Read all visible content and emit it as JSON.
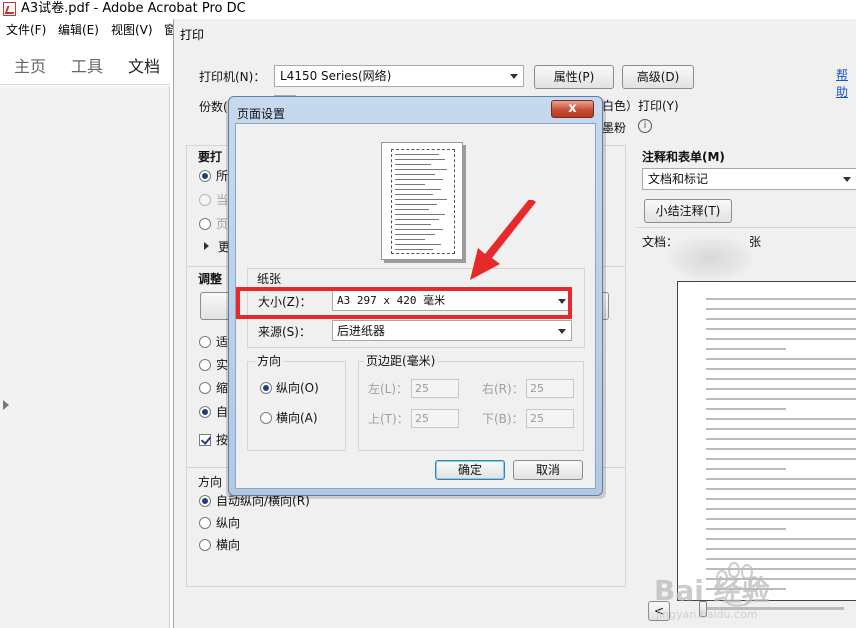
{
  "app": {
    "title": "A3试卷.pdf - Adobe Acrobat Pro DC",
    "menu": [
      "文件(F)",
      "编辑(E)",
      "视图(V)",
      "窗"
    ],
    "tabs": [
      "主页",
      "工具",
      "文档"
    ]
  },
  "print_dialog": {
    "title": "打印",
    "printer_label": "打印机(N)：",
    "printer_value": "L4150 Series(网络)",
    "properties_button": "属性(P)",
    "advanced_button": "高级(D)",
    "help_link": "帮助",
    "copies_label": "份数(",
    "grayscale_text": "白色）打印(Y)",
    "save_ink_text": "墨粉",
    "pages_section_title": "要打",
    "pages_options": [
      "所",
      "当",
      "页"
    ],
    "more_options": "更",
    "sizing_section_title": "调整",
    "sizing_options": [
      "适",
      "实",
      "缩",
      "自"
    ],
    "choose_paper_checkbox": "按",
    "orientation_section_title": "方向",
    "orientation_options": [
      "自动纵向/横向(R)",
      "纵向",
      "横向"
    ],
    "comments_title": "注释和表单(M)",
    "comments_value": "文档和标记",
    "summarize_button": "小结注释(T)",
    "doc_label": "文档：",
    "doc_label_tail": "张",
    "page_nav_prev": "<"
  },
  "page_setup": {
    "title": "页面设置",
    "close_label": "x",
    "paper_group": "纸张",
    "size_label": "大小(Z)：",
    "size_value": "A3 297 x 420 毫米",
    "source_label": "来源(S)：",
    "source_value": "后进纸器",
    "orientation_group": "方向",
    "portrait_label": "纵向(O)",
    "landscape_label": "横向(A)",
    "margins_group": "页边距(毫米)",
    "left_label": "左(L)：",
    "right_label": "右(R)：",
    "top_label": "上(T)：",
    "bottom_label": "下(B)：",
    "left_value": "25",
    "right_value": "25",
    "top_value": "25",
    "bottom_value": "25",
    "ok_button": "确定",
    "cancel_button": "取消"
  },
  "overlay": {
    "highlight_color": "#e8292c",
    "arrow_color": "#e8292c",
    "watermark_text": "Bai 经验",
    "watermark_url": "jingyan.baidu.com"
  }
}
